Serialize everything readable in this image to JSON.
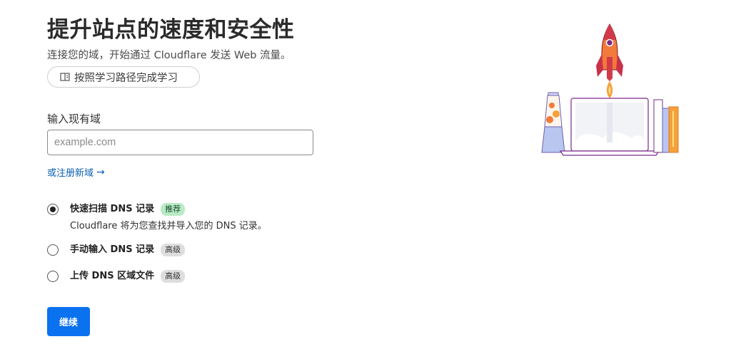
{
  "header": {
    "title": "提升站点的速度和安全性",
    "subtitle": "连接您的域，开始通过 Cloudflare 发送 Web 流量。",
    "learn_button": "按照学习路径完成学习"
  },
  "domain_form": {
    "label": "输入现有域",
    "placeholder": "example.com",
    "value": "",
    "register_link": "或注册新域",
    "register_arrow": "→"
  },
  "options": [
    {
      "title": "快速扫描 DNS 记录",
      "badge": "推荐",
      "description": "Cloudflare 将为您查找并导入您的 DNS 记录。",
      "selected": true
    },
    {
      "title": "手动输入 DNS 记录",
      "badge": "高级",
      "selected": false
    },
    {
      "title": "上传 DNS 区域文件",
      "badge": "高级",
      "selected": false
    }
  ],
  "continue_button": "继续",
  "colors": {
    "primary": "#0a72ef",
    "link": "#0a5fb4",
    "badge_recommended": "#b9ebc5",
    "badge_advanced": "#dedede"
  }
}
